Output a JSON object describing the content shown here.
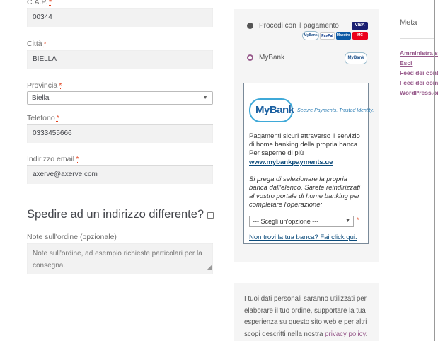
{
  "billing": {
    "cap_label": "C.A.P.",
    "cap_value": "00344",
    "citta_label": "Città",
    "citta_value": "BIELLA",
    "provincia_label": "Provincia",
    "provincia_value": "Biella",
    "telefono_label": "Telefono",
    "telefono_value": "0333455666",
    "email_label": "Indirizzo email",
    "email_value": "axerve@axerve.com",
    "required_mark": "*"
  },
  "shipping": {
    "title": "Spedire ad un indirizzo differente?",
    "checked": false
  },
  "notes": {
    "label": "Note sull'ordine (opzionale)",
    "placeholder": "Note sull'ordine, ad esempio richieste particolari per la consegna."
  },
  "payment": {
    "option1_label": "Procedi con il pagamento",
    "option2_label": "MyBank",
    "selected": "MyBank",
    "card_badges": [
      "VISA",
      "PayPal",
      "Maestro",
      "MC"
    ],
    "mini_logo": "MyBank",
    "colors": {
      "accent": "#96588a",
      "mybank_blue": "#1a5fa0",
      "link": "#0a4a7a"
    }
  },
  "mybank": {
    "logo_text": "MyBank",
    "tagline": "Secure Payments. Trusted Identity.",
    "description": "Pagamenti sicuri attraverso il servizio di home banking della propria banca. Per saperne di più",
    "link_text": "www.mybankpayments.ue",
    "instruction": "Si prega di selezionare la propria banca dall'elenco. Sarete reindirizzati al vostro portale di home banking per completare l'operazione:",
    "select_placeholder": "--- Scegli un'opzione ---",
    "help_link": "Non trovi la tua banca? Fai click qui."
  },
  "privacy": {
    "text": "I tuoi dati personali saranno utilizzati per elaborare il tuo ordine, supportare la tua esperienza su questo sito web e per altri scopi descritti nella nostra",
    "link": "privacy policy",
    "end": "."
  },
  "meta": {
    "title": "Meta",
    "items": [
      "Amministra sito",
      "Esci",
      "Feed dei contenuti",
      "Feed dei commenti",
      "WordPress.org"
    ]
  }
}
